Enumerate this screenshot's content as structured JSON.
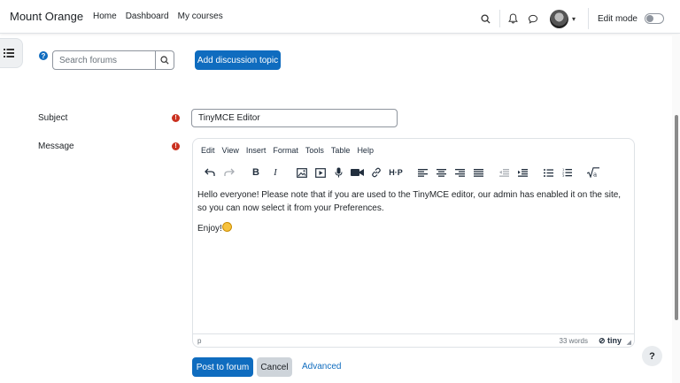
{
  "header": {
    "brand": "Mount Orange",
    "nav": [
      "Home",
      "Dashboard",
      "My courses"
    ],
    "edit_mode_label": "Edit mode",
    "edit_mode_on": false
  },
  "forum": {
    "search_placeholder": "Search forums",
    "add_topic_label": "Add discussion topic"
  },
  "form": {
    "subject_label": "Subject",
    "subject_value": "TinyMCE Editor",
    "message_label": "Message",
    "required_icon": "exclamation-circle-icon"
  },
  "editor": {
    "menu": [
      "Edit",
      "View",
      "Insert",
      "Format",
      "Tools",
      "Table",
      "Help"
    ],
    "content_p1": "Hello everyone! Please note that if you are used to the TinyMCE editor, our admin has enabled it on the site, so you can now select it from your Preferences.",
    "content_p2": "Enjoy!",
    "status_path": "p",
    "word_count": "33 words",
    "brand": "tiny"
  },
  "actions": {
    "post_label": "Post to forum",
    "cancel_label": "Cancel",
    "advanced_label": "Advanced"
  },
  "colors": {
    "primary": "#0f6cbf",
    "danger": "#ca3120"
  }
}
